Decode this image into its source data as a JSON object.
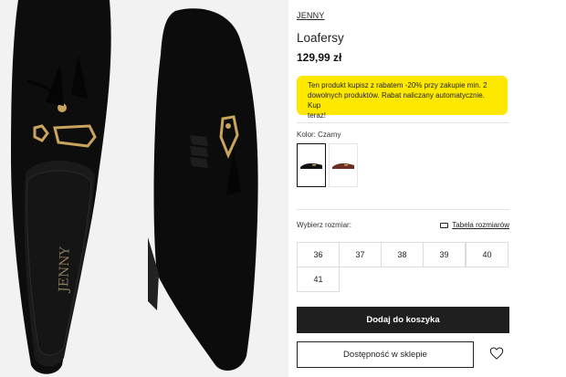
{
  "product": {
    "brand": "JENNY",
    "name": "Loafersy",
    "price": "129,99 zł",
    "insole_logo": "JENNY"
  },
  "promo": {
    "text_lines": [
      "Ten produkt kupisz z rabatem -20% przy zakupie min. 2",
      "dowolnych produktów. Rabat naliczany automatycznie. Kup",
      "teraz!"
    ]
  },
  "colors": {
    "label": "Kolor: Czarny",
    "options": [
      {
        "name": "Czarny",
        "swatch": "#111111",
        "selected": true
      },
      {
        "name": "Brązowy",
        "swatch": "#6b2e20",
        "selected": false
      }
    ]
  },
  "sizes": {
    "label": "Wybierz rozmiar:",
    "guide_label": "Tabela rozmiarów",
    "options": [
      "36",
      "37",
      "38",
      "39",
      "40",
      "41"
    ]
  },
  "actions": {
    "add_to_cart": "Dodaj do koszyka",
    "store_availability": "Dostępność w sklepie"
  },
  "theme": {
    "promo_bg": "#ffe800",
    "primary_button": "#1f1f1f",
    "gallery_bg": "#f2f2f2"
  }
}
